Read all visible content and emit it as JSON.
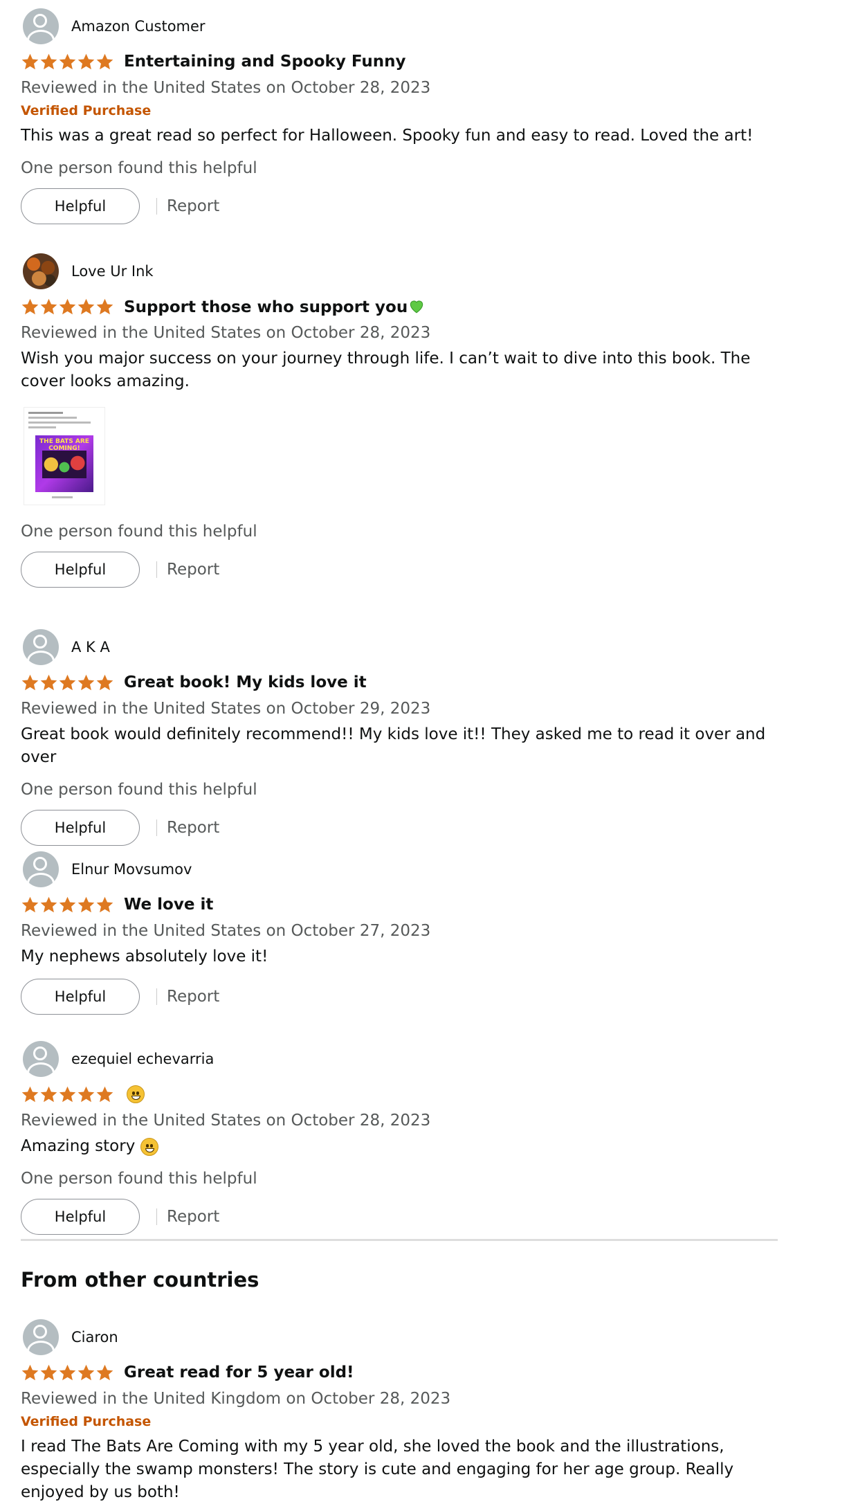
{
  "colors": {
    "star": "#de7921",
    "verified": "#c45500",
    "muted": "#565959"
  },
  "reviews": [
    {
      "name": "Amazon Customer",
      "avatar": "default-avatar-icon",
      "stars": 5,
      "title": "Entertaining and Spooky Funny",
      "date": "Reviewed in the United States on October 28, 2023",
      "verified": "Verified Purchase",
      "text": "This was a great read so perfect for Halloween. Spooky fun and easy to read. Loved the art!",
      "helpful_count": "One person found this helpful",
      "helpful_label": "Helpful",
      "report_label": "Report"
    },
    {
      "name": "Love Ur Ink",
      "avatar": "user-photo-avatar",
      "stars": 5,
      "title": "Support those who support you",
      "title_icon": "green-heart-emoji",
      "date": "Reviewed in the United States on October 28, 2023",
      "text": "Wish you major success on your journey through life. I can’t wait to dive into this book. The cover looks amazing.",
      "image_text": "THE BATS ARE COMING!",
      "helpful_count": "One person found this helpful",
      "helpful_label": "Helpful",
      "report_label": "Report"
    },
    {
      "name": "A K A",
      "avatar": "default-avatar-icon",
      "stars": 5,
      "title": "Great book! My kids love it",
      "date": "Reviewed in the United States on October 29, 2023",
      "text": "Great book would definitely recommend!! My kids love it!! They asked me to read it over and over",
      "helpful_count": "One person found this helpful",
      "helpful_label": "Helpful",
      "report_label": "Report"
    },
    {
      "name": "Elnur Movsumov",
      "avatar": "default-avatar-icon",
      "stars": 5,
      "title": "We love it",
      "date": "Reviewed in the United States on October 27, 2023",
      "text": "My nephews absolutely love it!",
      "helpful_label": "Helpful",
      "report_label": "Report"
    },
    {
      "name": "ezequiel echevarria",
      "avatar": "default-avatar-icon",
      "stars": 5,
      "title_icon": "grinning-face-emoji",
      "date": "Reviewed in the United States on October 28, 2023",
      "text": "Amazing story",
      "text_icon": "grinning-face-emoji",
      "helpful_count": "One person found this helpful",
      "helpful_label": "Helpful",
      "report_label": "Report"
    }
  ],
  "other_countries": {
    "heading": "From other countries",
    "review": {
      "name": "Ciaron",
      "avatar": "default-avatar-icon",
      "stars": 5,
      "title": "Great read for 5 year old!",
      "date": "Reviewed in the United Kingdom on October 28, 2023",
      "verified": "Verified Purchase",
      "text": "I read The Bats Are Coming with my 5 year old, she loved the book and the illustrations, especially the swamp monsters! The story is cute and engaging for her age group. Really enjoyed by us both!"
    }
  }
}
